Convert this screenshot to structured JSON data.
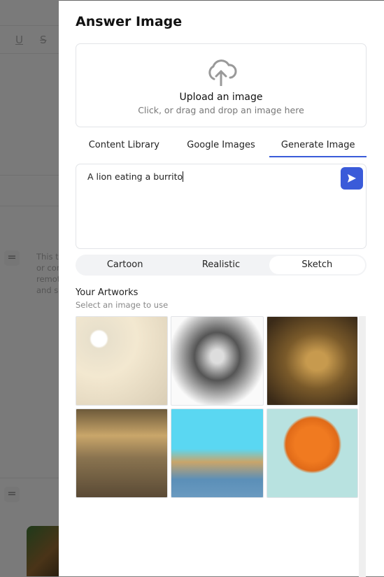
{
  "background": {
    "toolbar_icons": [
      "underline-icon",
      "strikethrough-icon"
    ],
    "snippet_lines": [
      "This ty",
      "or cor",
      "remot",
      "and s"
    ]
  },
  "dialog": {
    "title": "Answer Image",
    "upload": {
      "title": "Upload an image",
      "subtitle": "Click, or drag and drop an image here",
      "icon": "cloud-upload-icon"
    },
    "tabs": [
      {
        "label": "Content Library"
      },
      {
        "label": "Google Images"
      },
      {
        "label": "Generate Image",
        "active": true
      }
    ],
    "prompt": {
      "value": "A lion eating a burrito",
      "send_icon": "send-icon"
    },
    "styles": [
      {
        "label": "Cartoon"
      },
      {
        "label": "Realistic"
      },
      {
        "label": "Sketch",
        "active": true
      }
    ],
    "artworks": {
      "heading": "Your Artworks",
      "subheading": "Select an image to use",
      "images": [
        "sketch-lion-sleeping-burrito",
        "sketch-lion-holding-burrito",
        "realistic-lion-biting-burrito",
        "realistic-lion-savanna-burrito",
        "cartoon-lion-table-burrito",
        "cartoon-orange-lion-burrito"
      ]
    },
    "accent": "#3a5bd9"
  }
}
